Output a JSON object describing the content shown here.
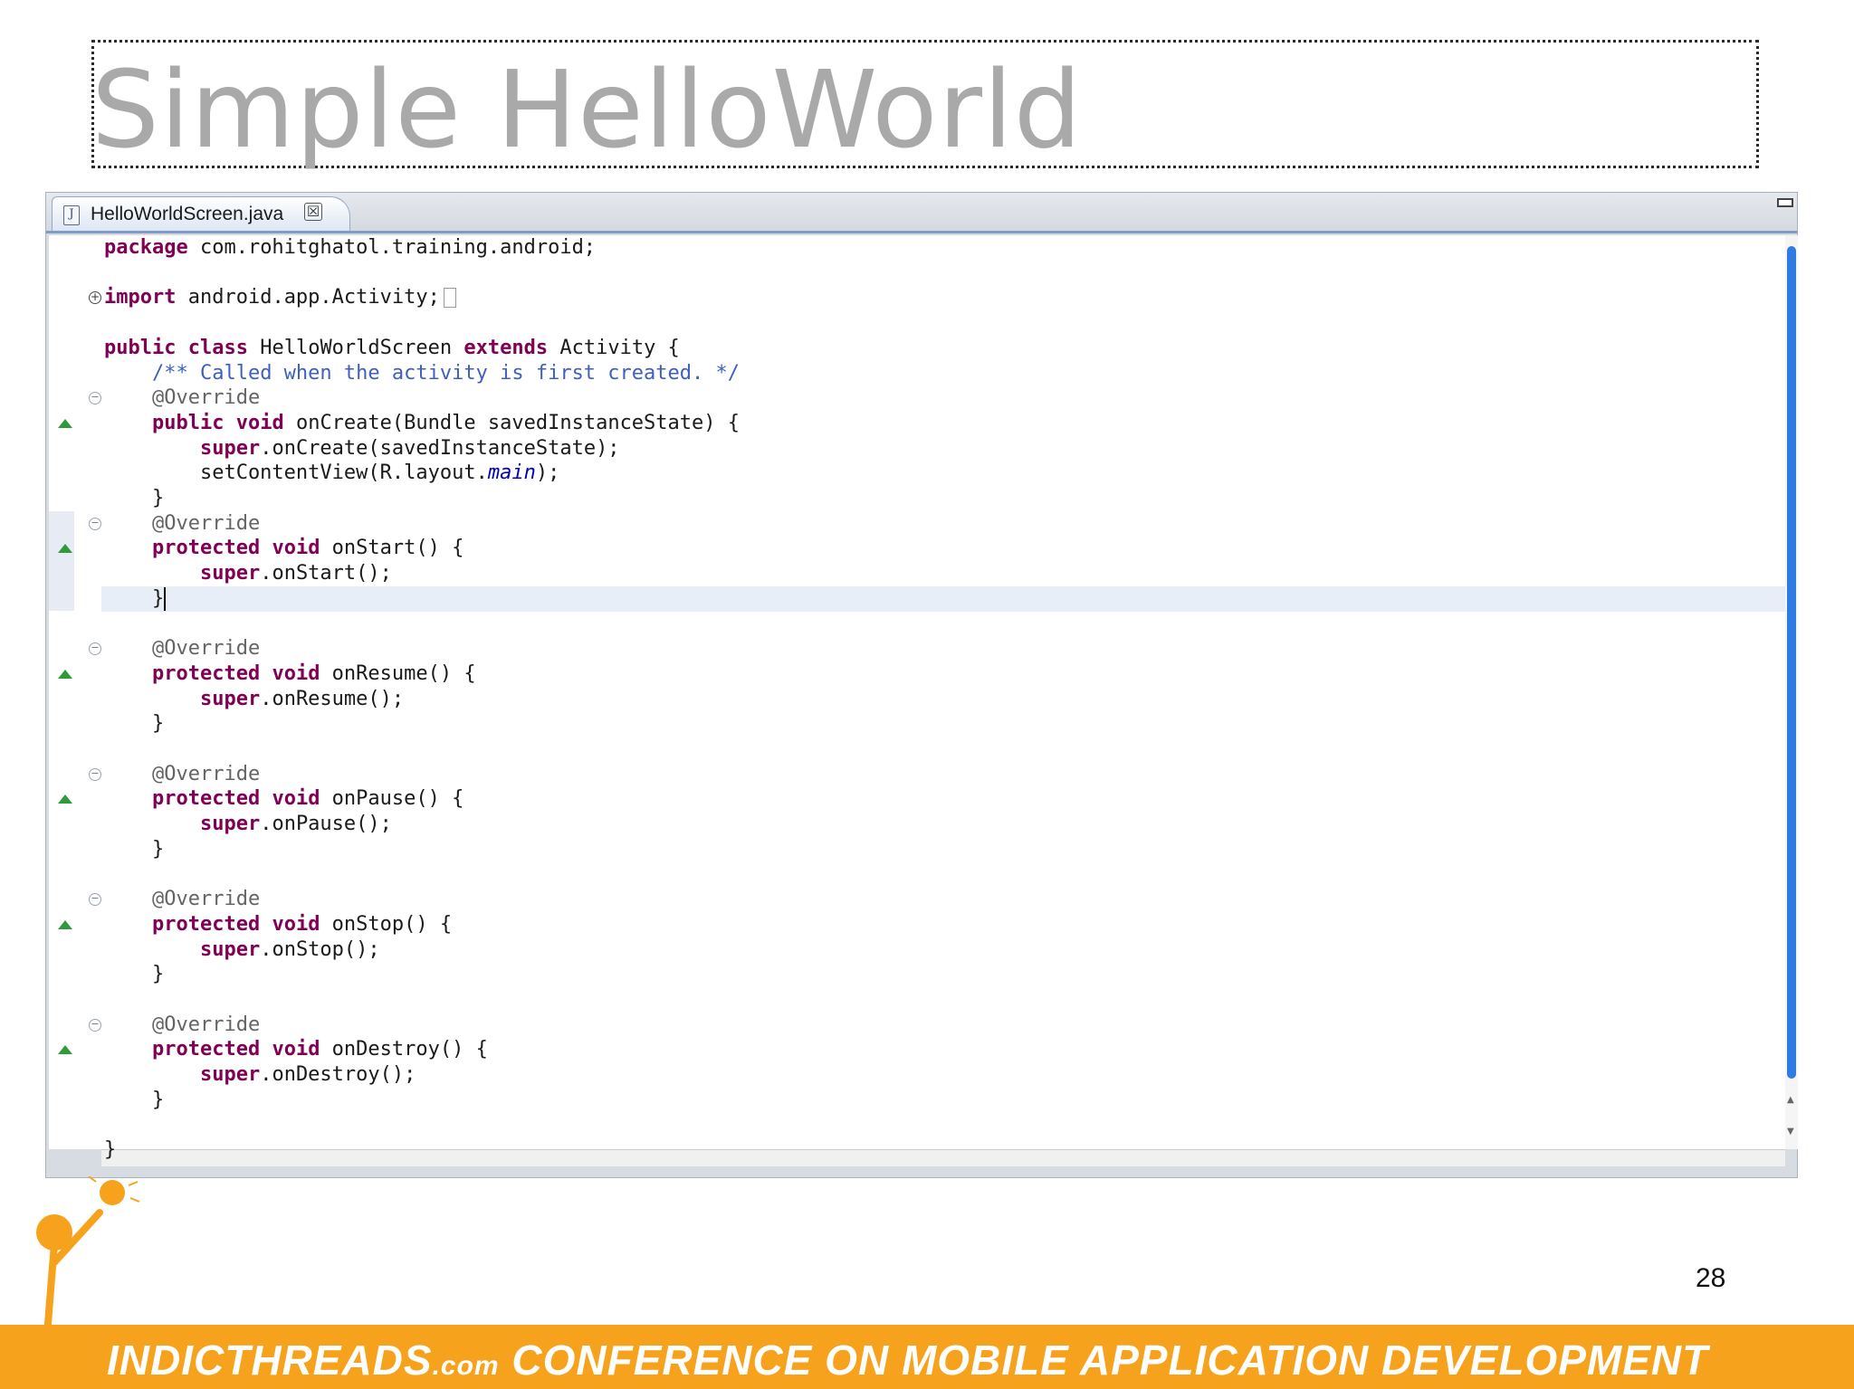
{
  "slide": {
    "title": "Simple HelloWorld",
    "page_number": "28"
  },
  "editor": {
    "tab_label": "HelloWorldScreen.java",
    "tab_close_glyph": "☒",
    "file_icon_glyph": "J",
    "lines": [
      [
        {
          "t": "package",
          "c": "kw"
        },
        {
          "t": " com.rohitghatol.training.android;"
        }
      ],
      [],
      [
        {
          "t": "import",
          "c": "kw"
        },
        {
          "t": " android.app.Activity;"
        }
      ],
      [],
      [
        {
          "t": "public",
          "c": "kw"
        },
        {
          "t": " "
        },
        {
          "t": "class",
          "c": "kw"
        },
        {
          "t": " HelloWorldScreen "
        },
        {
          "t": "extends",
          "c": "kw"
        },
        {
          "t": " Activity {"
        }
      ],
      [
        {
          "t": "    "
        },
        {
          "t": "/** Called when the activity is first created. */",
          "c": "cm"
        }
      ],
      [
        {
          "t": "    "
        },
        {
          "t": "@Override",
          "c": "ann"
        }
      ],
      [
        {
          "t": "    "
        },
        {
          "t": "public",
          "c": "kw"
        },
        {
          "t": " "
        },
        {
          "t": "void",
          "c": "kw"
        },
        {
          "t": " onCreate(Bundle savedInstanceState) {"
        }
      ],
      [
        {
          "t": "        "
        },
        {
          "t": "super",
          "c": "kw"
        },
        {
          "t": ".onCreate(savedInstanceState);"
        }
      ],
      [
        {
          "t": "        setContentView(R.layout."
        },
        {
          "t": "main",
          "c": "it"
        },
        {
          "t": ");"
        }
      ],
      [
        {
          "t": "    }"
        }
      ],
      [
        {
          "t": "    "
        },
        {
          "t": "@Override",
          "c": "ann"
        }
      ],
      [
        {
          "t": "    "
        },
        {
          "t": "protected",
          "c": "kw"
        },
        {
          "t": " "
        },
        {
          "t": "void",
          "c": "kw"
        },
        {
          "t": " onStart() {"
        }
      ],
      [
        {
          "t": "        "
        },
        {
          "t": "super",
          "c": "kw"
        },
        {
          "t": ".onStart();"
        }
      ],
      [
        {
          "t": "    }"
        }
      ],
      [],
      [
        {
          "t": "    "
        },
        {
          "t": "@Override",
          "c": "ann"
        }
      ],
      [
        {
          "t": "    "
        },
        {
          "t": "protected",
          "c": "kw"
        },
        {
          "t": " "
        },
        {
          "t": "void",
          "c": "kw"
        },
        {
          "t": " onResume() {"
        }
      ],
      [
        {
          "t": "        "
        },
        {
          "t": "super",
          "c": "kw"
        },
        {
          "t": ".onResume();"
        }
      ],
      [
        {
          "t": "    }"
        }
      ],
      [],
      [
        {
          "t": "    "
        },
        {
          "t": "@Override",
          "c": "ann"
        }
      ],
      [
        {
          "t": "    "
        },
        {
          "t": "protected",
          "c": "kw"
        },
        {
          "t": " "
        },
        {
          "t": "void",
          "c": "kw"
        },
        {
          "t": " onPause() {"
        }
      ],
      [
        {
          "t": "        "
        },
        {
          "t": "super",
          "c": "kw"
        },
        {
          "t": ".onPause();"
        }
      ],
      [
        {
          "t": "    }"
        }
      ],
      [],
      [
        {
          "t": "    "
        },
        {
          "t": "@Override",
          "c": "ann"
        }
      ],
      [
        {
          "t": "    "
        },
        {
          "t": "protected",
          "c": "kw"
        },
        {
          "t": " "
        },
        {
          "t": "void",
          "c": "kw"
        },
        {
          "t": " onStop() {"
        }
      ],
      [
        {
          "t": "        "
        },
        {
          "t": "super",
          "c": "kw"
        },
        {
          "t": ".onStop();"
        }
      ],
      [
        {
          "t": "    }"
        }
      ],
      [],
      [
        {
          "t": "    "
        },
        {
          "t": "@Override",
          "c": "ann"
        }
      ],
      [
        {
          "t": "    "
        },
        {
          "t": "protected",
          "c": "kw"
        },
        {
          "t": " "
        },
        {
          "t": "void",
          "c": "kw"
        },
        {
          "t": " onDestroy() {"
        }
      ],
      [
        {
          "t": "        "
        },
        {
          "t": "super",
          "c": "kw"
        },
        {
          "t": ".onDestroy();"
        }
      ],
      [
        {
          "t": "    }"
        }
      ],
      [],
      [
        {
          "t": "}"
        }
      ]
    ]
  },
  "footer": {
    "brand": "INDICTHREADS",
    "brand_suffix": ".com",
    "tagline": " CONFERENCE ON MOBILE APPLICATION DEVELOPMENT"
  },
  "colors": {
    "footer_bar": "#f7a21c",
    "keyword": "#7f0055",
    "comment": "#3f5fbf",
    "annotation": "#646464"
  }
}
